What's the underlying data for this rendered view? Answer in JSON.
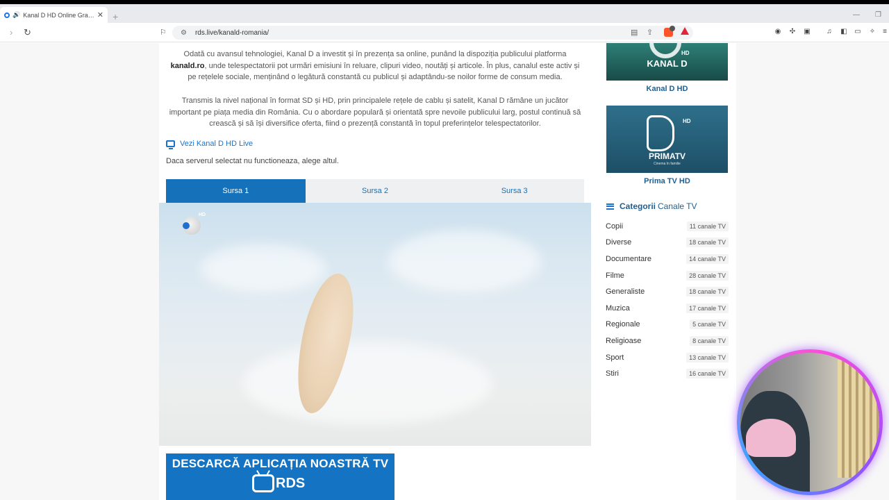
{
  "browser": {
    "tab_title": "Kanal D HD Online Gratis - RDS",
    "url": "rds.live/kanald-romania/"
  },
  "article": {
    "para1_a": "Odată cu avansul tehnologiei, Kanal D a investit și în prezența sa online, punând la dispoziția publicului platforma",
    "para1_site": "kanald.ro",
    "para1_b": ", unde telespectatorii pot urmări emisiuni în reluare, clipuri video, noutăți și articole. În plus, canalul este activ și pe rețelele sociale, menținând o legătură constantă cu publicul și adaptându-se noilor forme de consum media.",
    "para2": "Transmis la nivel național în format SD și HD, prin principalele rețele de cablu și satelit, Kanal D rămâne un jucător important pe piața media din România. Cu o abordare populară și orientată spre nevoile publicului larg, postul continuă să crească și să își diversifice oferta, fiind o prezență constantă în topul preferințelor telespectatorilor.",
    "live_link": "Vezi Kanal D HD Live",
    "server_note": "Daca serverul selectat nu functioneaza, alege altul."
  },
  "sources": [
    {
      "label": "Sursa 1",
      "active": true
    },
    {
      "label": "Sursa 2",
      "active": false
    },
    {
      "label": "Sursa 3",
      "active": false
    }
  ],
  "player": {
    "channel_logo": "kanal-d-hd-logo",
    "logo_hd": "HD"
  },
  "app_banner": {
    "text": "DESCARCĂ APLICAȚIA NOASTRĂ TV",
    "logo": "RDS"
  },
  "sidebar": {
    "channels": [
      {
        "name": "Kanal D HD",
        "logo_text": "KANAL D",
        "logo_hd": "HD"
      },
      {
        "name": "Prima TV HD",
        "logo_text": "PRIMATV",
        "logo_hd": "HD",
        "logo_sub": "Cinema în familie"
      }
    ],
    "categories_title_bold": "Categorii",
    "categories_title_rest": "Canale TV",
    "categories": [
      {
        "name": "Copii",
        "count": "11 canale TV"
      },
      {
        "name": "Diverse",
        "count": "18 canale TV"
      },
      {
        "name": "Documentare",
        "count": "14 canale TV"
      },
      {
        "name": "Filme",
        "count": "28 canale TV"
      },
      {
        "name": "Generaliste",
        "count": "18 canale TV"
      },
      {
        "name": "Muzica",
        "count": "17 canale TV"
      },
      {
        "name": "Regionale",
        "count": "5 canale TV"
      },
      {
        "name": "Religioase",
        "count": "8 canale TV"
      },
      {
        "name": "Sport",
        "count": "13 canale TV"
      },
      {
        "name": "Stiri",
        "count": "16 canale TV"
      }
    ]
  },
  "colors": {
    "accent": "#1571b9",
    "link": "#1a73c8",
    "banner": "#1473c2"
  }
}
